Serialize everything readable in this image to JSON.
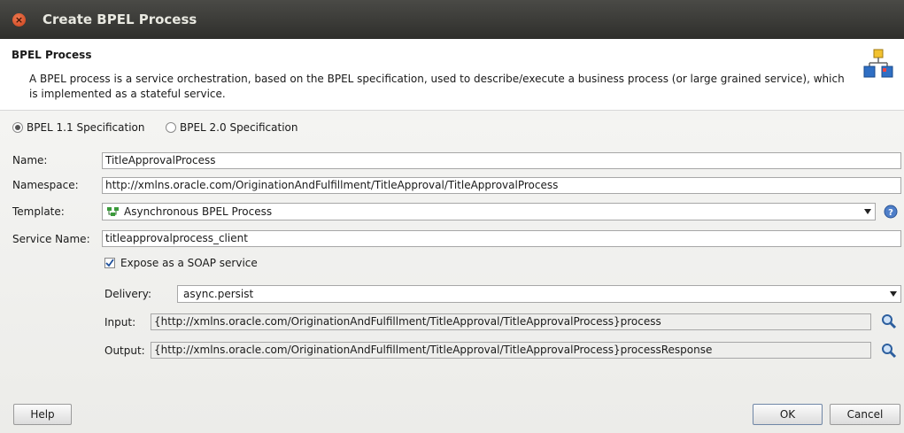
{
  "window": {
    "title": "Create BPEL Process"
  },
  "header": {
    "title": "BPEL Process",
    "description": "A BPEL process is a service orchestration, based on the BPEL specification, used to describe/execute a business process (or large grained service), which is implemented as a stateful service."
  },
  "spec": {
    "option1": "BPEL 1.1 Specification",
    "option2": "BPEL 2.0 Specification",
    "selected": "BPEL 1.1 Specification"
  },
  "form": {
    "name_label": "Name:",
    "name_value": "TitleApprovalProcess",
    "namespace_label": "Namespace:",
    "namespace_value": "http://xmlns.oracle.com/OriginationAndFulfillment/TitleApproval/TitleApprovalProcess",
    "template_label": "Template:",
    "template_value": "Asynchronous BPEL Process",
    "service_name_label": "Service Name:",
    "service_name_value": "titleapprovalprocess_client",
    "expose_label": "Expose as a SOAP service",
    "expose_checked": true,
    "delivery_label": "Delivery:",
    "delivery_value": "async.persist",
    "input_label": "Input:",
    "input_value": "{http://xmlns.oracle.com/OriginationAndFulfillment/TitleApproval/TitleApprovalProcess}process",
    "output_label": "Output:",
    "output_value": "{http://xmlns.oracle.com/OriginationAndFulfillment/TitleApproval/TitleApprovalProcess}processResponse"
  },
  "buttons": {
    "help": "Help",
    "ok": "OK",
    "cancel": "Cancel"
  },
  "icons": {
    "close": "close-icon",
    "process": "bpel-process-icon",
    "template": "bpel-template-icon",
    "help": "help-icon",
    "search": "magnifier-icon"
  },
  "colors": {
    "titlebar": "#3a3a37",
    "close": "#e05a2e",
    "accent": "#6f86a6"
  }
}
